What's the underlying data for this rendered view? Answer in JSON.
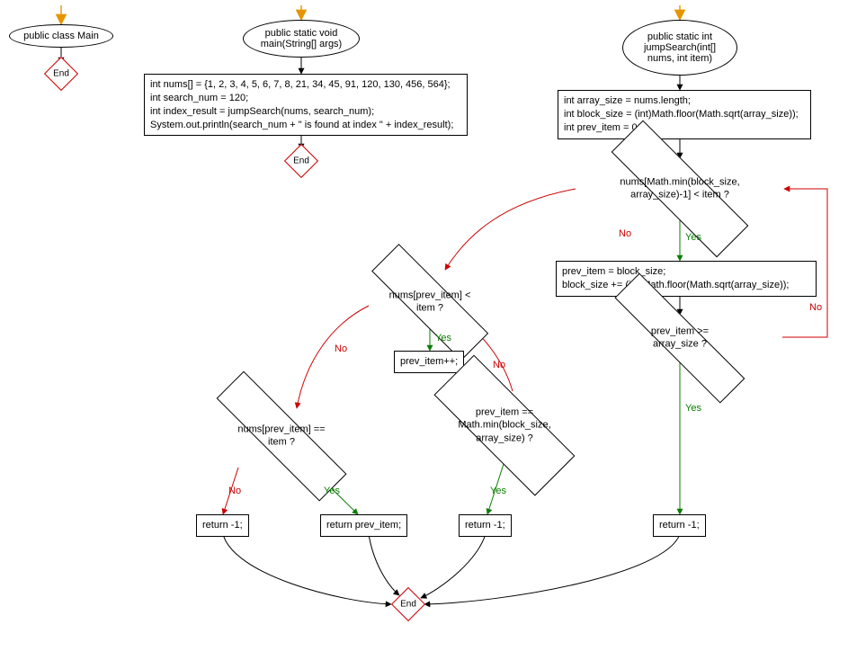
{
  "labels": {
    "yes": "Yes",
    "no": "No",
    "end": "End"
  },
  "fc1": {
    "start": "public class Main"
  },
  "fc2": {
    "start": "public static void\nmain(String[] args)",
    "body": "int nums[] = {1, 2, 3, 4, 5, 6, 7, 8, 21, 34, 45, 91, 120, 130, 456, 564};\nint search_num = 120;\nint index_result = jumpSearch(nums, search_num);\nSystem.out.println(search_num + \" is found at index \" + index_result);"
  },
  "fc3": {
    "start": "public static int\njumpSearch(int[]\nnums, int item)",
    "init": "int array_size = nums.length;\nint block_size = (int)Math.floor(Math.sqrt(array_size));\nint prev_item = 0;",
    "cond1": "nums[Math.min(block_size,\narray_size)-1] < item ?",
    "body1": "prev_item = block_size;\nblock_size += (int)Math.floor(Math.sqrt(array_size));",
    "cond2": "prev_item >= array_size ?",
    "ret_neg1_a": "return -1;",
    "cond3": "nums[prev_item] < item ?",
    "inc": "prev_item++;",
    "cond4": "prev_item ==\nMath.min(block_size,\narray_size) ?",
    "ret_neg1_b": "return -1;",
    "cond5": "nums[prev_item] == item ?",
    "ret_prev": "return prev_item;",
    "ret_neg1_c": "return -1;"
  }
}
